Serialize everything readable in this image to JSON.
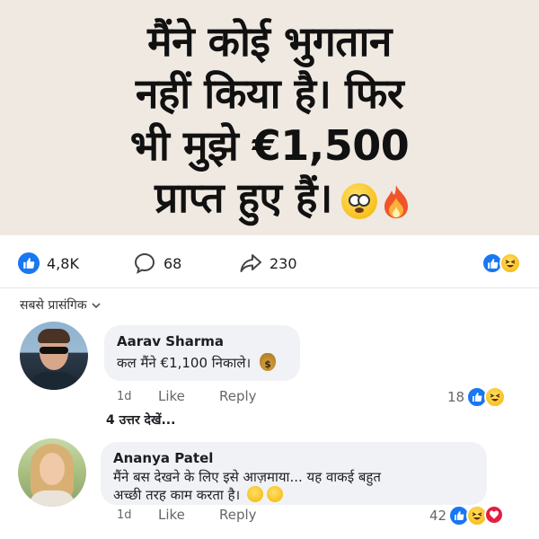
{
  "headline": {
    "lines": [
      "मैंने कोई भुगतान",
      "नहीं किया है। फिर",
      "भी मुझे €1,500",
      "प्राप्त हुए हैं।"
    ],
    "emojis": [
      "flushed-face-icon",
      "fire-icon"
    ],
    "background": "#efe9e2"
  },
  "stats": {
    "likes": "4,8K",
    "comments": "68",
    "shares": "230",
    "reactions": [
      "like-icon",
      "haha-icon"
    ]
  },
  "sort": {
    "label": "सबसे प्रासंगिक"
  },
  "comments": [
    {
      "author": "Aarav Sharma",
      "text": "कल मैंने €1,100 निकाले।",
      "emoji": "money-bag-icon",
      "time": "1d",
      "like_label": "Like",
      "reply_label": "Reply",
      "reaction_count": "18",
      "reactions": [
        "like-icon",
        "haha-icon"
      ]
    },
    {
      "author": "Ananya Patel",
      "text_line1": "मैंने बस देखने के लिए इसे आज़माया... यह वाकई बहुत",
      "text_line2": "अच्छी तरह काम करता है।",
      "emoji": "grinning-face-icon",
      "time": "1d",
      "like_label": "Like",
      "reply_label": "Reply",
      "reaction_count": "42",
      "reactions": [
        "like-icon",
        "haha-icon",
        "love-icon"
      ]
    }
  ],
  "view_replies": "4 उत्तर देखें...",
  "colors": {
    "facebook_blue": "#1877f2",
    "love_red": "#e41e3f",
    "bubble_gray": "#f0f2f5"
  }
}
